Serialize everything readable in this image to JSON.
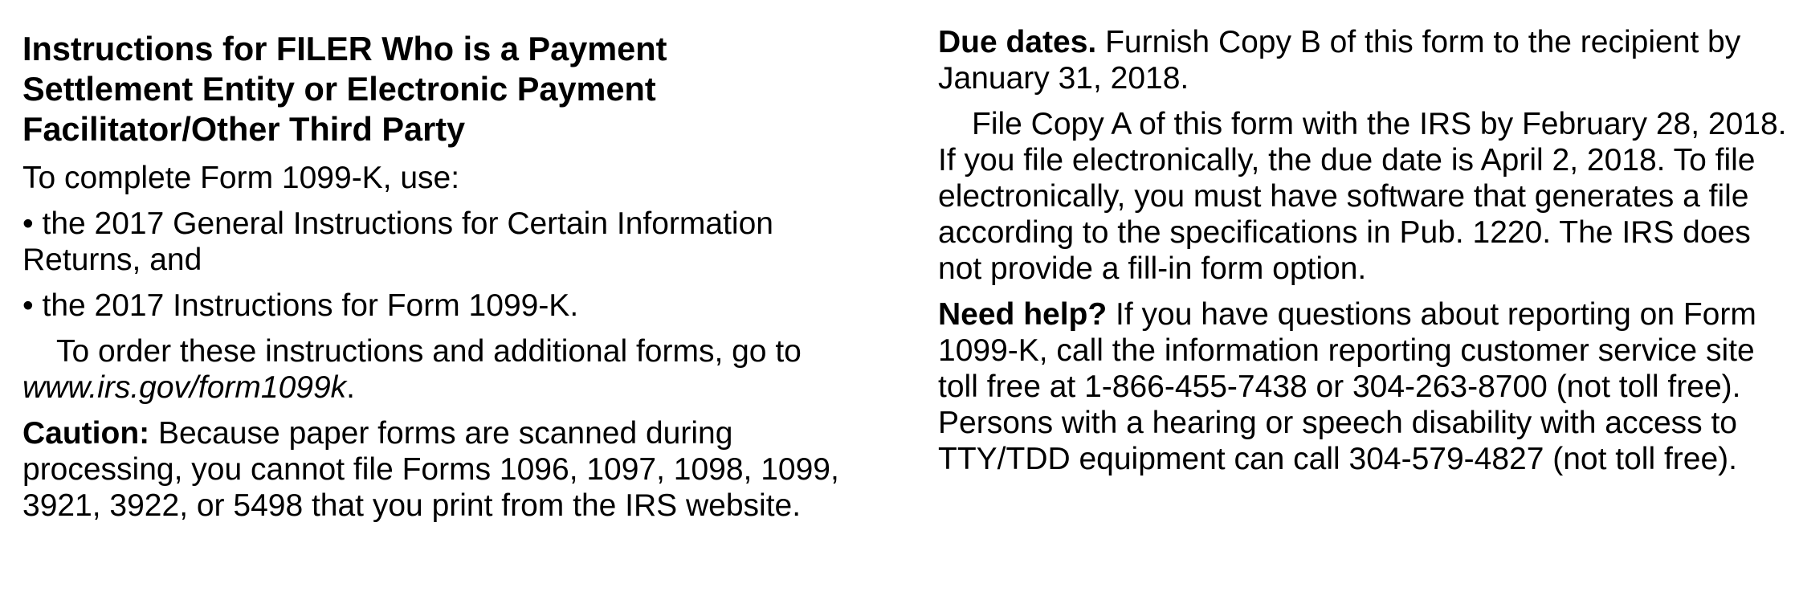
{
  "left": {
    "heading_lines": [
      "Instructions for FILER Who is a Payment",
      "Settlement Entity or Electronic Payment",
      "Facilitator/Other Third Party"
    ],
    "intro": "To complete Form 1099-K, use:",
    "bullet_1": "• the 2017 General Instructions for Certain Information Returns, and",
    "bullet_2": "• the 2017 Instructions for Form 1099-K.",
    "order_text": "To order these instructions and additional forms, go to ",
    "order_link": "www.irs.gov/form1099k",
    "order_end": ".",
    "caution_label": "Caution:",
    "caution_text": " Because paper forms are scanned during processing, you cannot file Forms 1096, 1097, 1098, 1099, 3921, 3922, or 5498 that you print from the IRS website."
  },
  "right": {
    "due_label": "Due dates.",
    "due_text": " Furnish Copy B of this form to the recipient by January 31, 2018.",
    "file_text": "File Copy A of this form with the IRS by February 28, 2018. If you file electronically, the due date is April 2, 2018. To file electronically, you must have software that generates a file according to the specifications in Pub. 1220. The IRS does not provide a fill-in form option.",
    "help_label": "Need help?",
    "help_text": " If you have questions about reporting on Form 1099-K, call the information reporting customer service site toll free at 1-866-455-7438 or 304-263-8700 (not toll free). Persons with a hearing or speech disability with access to TTY/TDD equipment can call 304-579-4827 (not toll free)."
  }
}
